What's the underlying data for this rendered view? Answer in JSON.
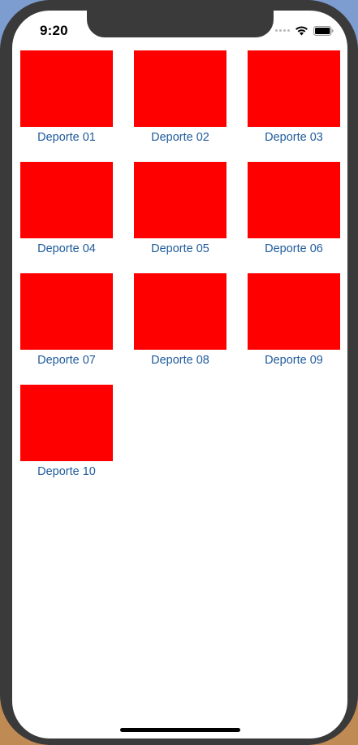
{
  "status_bar": {
    "time": "9:20"
  },
  "colors": {
    "thumbnail": "#ff0000",
    "label": "#1f5b9c",
    "background": "#ffffff",
    "bezel": "#3a3a3a"
  },
  "icons": {
    "signal": "cellular-signal-icon",
    "wifi": "wifi-icon",
    "battery": "battery-icon"
  },
  "sports": {
    "items": [
      {
        "label": "Deporte 01"
      },
      {
        "label": "Deporte 02"
      },
      {
        "label": "Deporte 03"
      },
      {
        "label": "Deporte 04"
      },
      {
        "label": "Deporte 05"
      },
      {
        "label": "Deporte 06"
      },
      {
        "label": "Deporte 07"
      },
      {
        "label": "Deporte 08"
      },
      {
        "label": "Deporte 09"
      },
      {
        "label": "Deporte 10"
      }
    ]
  }
}
